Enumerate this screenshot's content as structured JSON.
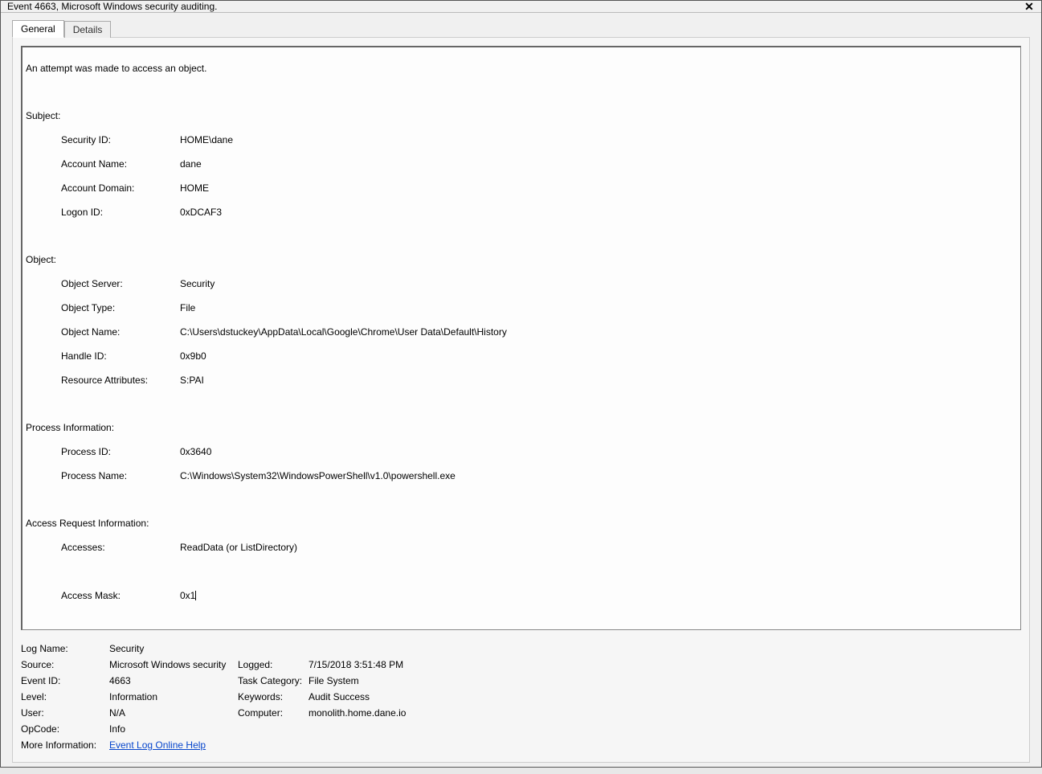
{
  "window": {
    "title": "Event 4663, Microsoft Windows security auditing."
  },
  "tabs": {
    "general": "General",
    "details": "Details"
  },
  "message": {
    "headline": "An attempt was made to access an object.",
    "subject": {
      "header": "Subject:",
      "security_id_lbl": "Security ID:",
      "security_id_val": "HOME\\dane",
      "account_name_lbl": "Account Name:",
      "account_name_val": "dane",
      "account_domain_lbl": "Account Domain:",
      "account_domain_val": "HOME",
      "logon_id_lbl": "Logon ID:",
      "logon_id_val": "0xDCAF3"
    },
    "object": {
      "header": "Object:",
      "object_server_lbl": "Object Server:",
      "object_server_val": "Security",
      "object_type_lbl": "Object Type:",
      "object_type_val": "File",
      "object_name_lbl": "Object Name:",
      "object_name_val": "C:\\Users\\dstuckey\\AppData\\Local\\Google\\Chrome\\User Data\\Default\\History",
      "handle_id_lbl": "Handle ID:",
      "handle_id_val": "0x9b0",
      "resource_attrs_lbl": "Resource Attributes:",
      "resource_attrs_val": "S:PAI"
    },
    "process": {
      "header": "Process Information:",
      "process_id_lbl": "Process ID:",
      "process_id_val": "0x3640",
      "process_name_lbl": "Process Name:",
      "process_name_val": "C:\\Windows\\System32\\WindowsPowerShell\\v1.0\\powershell.exe"
    },
    "access": {
      "header": "Access Request Information:",
      "accesses_lbl": "Accesses:",
      "accesses_val": "ReadData (or ListDirectory)",
      "access_mask_lbl": "Access Mask:",
      "access_mask_val": "0x1"
    }
  },
  "meta": {
    "log_name_lbl": "Log Name:",
    "log_name_val": "Security",
    "source_lbl": "Source:",
    "source_val": "Microsoft Windows security",
    "logged_lbl": "Logged:",
    "logged_val": "7/15/2018 3:51:48 PM",
    "event_id_lbl": "Event ID:",
    "event_id_val": "4663",
    "task_cat_lbl": "Task Category:",
    "task_cat_val": "File System",
    "level_lbl": "Level:",
    "level_val": "Information",
    "keywords_lbl": "Keywords:",
    "keywords_val": "Audit Success",
    "user_lbl": "User:",
    "user_val": "N/A",
    "computer_lbl": "Computer:",
    "computer_val": "monolith.home.dane.io",
    "opcode_lbl": "OpCode:",
    "opcode_val": "Info",
    "more_info_lbl": "More Information:",
    "more_info_link": "Event Log Online Help"
  }
}
